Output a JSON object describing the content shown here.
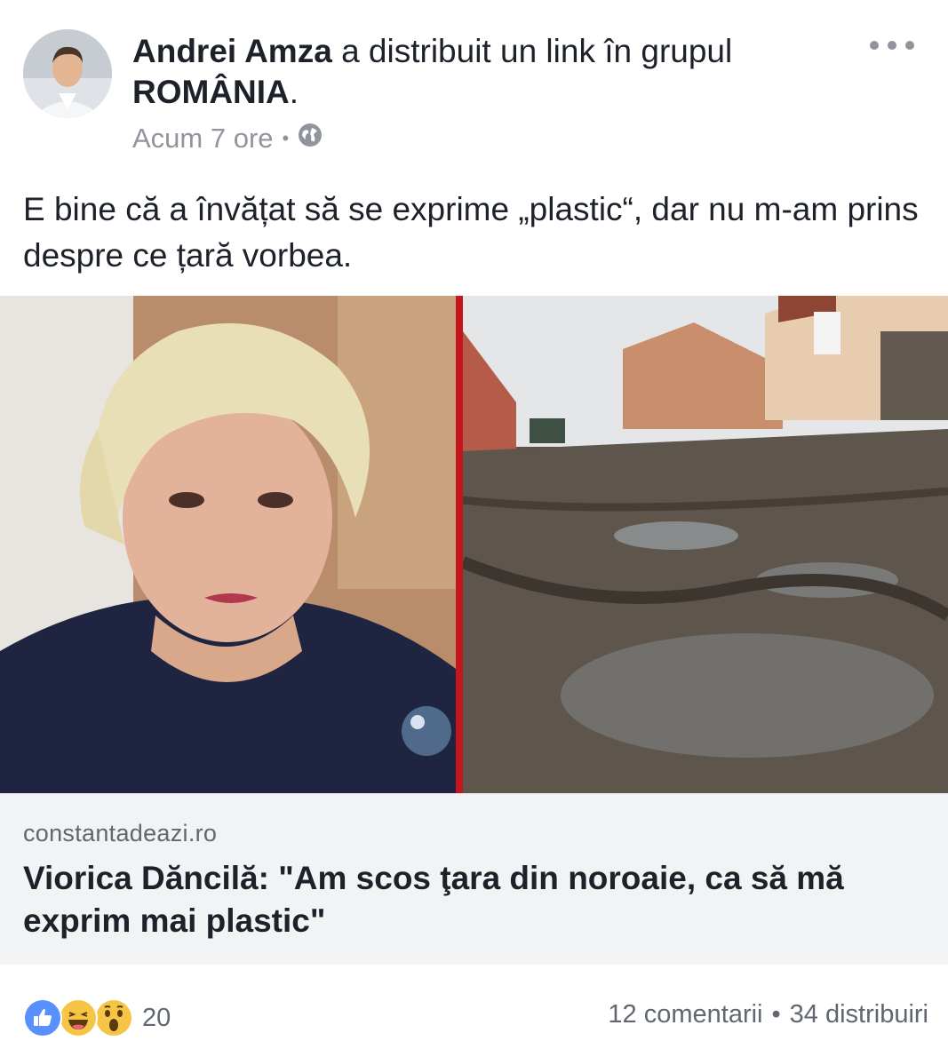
{
  "post": {
    "author": "Andrei Amza",
    "action_text": "a distribuit un link în grupul",
    "group_name": "ROMÂNIA",
    "group_suffix": ".",
    "timestamp": "Acum 7 ore",
    "separator": "•",
    "privacy_icon": "globe-icon",
    "more_icon": "more-options-icon",
    "message": "E bine că a învățat să se exprime „plastic“, dar nu m-am prins despre ce țară vorbea."
  },
  "link": {
    "domain": "constantadeazi.ro",
    "title": "Viorica Dăncilă: \"Am scos ţara din noroaie, ca să mă exprim mai plastic\""
  },
  "footer": {
    "reaction_icons": [
      "like-icon",
      "haha-icon",
      "wow-icon"
    ],
    "reaction_count": "20",
    "comments": "12 comentarii",
    "separator": "•",
    "shares": "34 distribuiri"
  },
  "colors": {
    "text": "#1d2129",
    "secondary": "#90949c",
    "caption_bg": "#f2f3f5",
    "divider_red": "#c4161c",
    "like_blue": "#5890ff",
    "emoji_yellow": "#f7c546"
  }
}
